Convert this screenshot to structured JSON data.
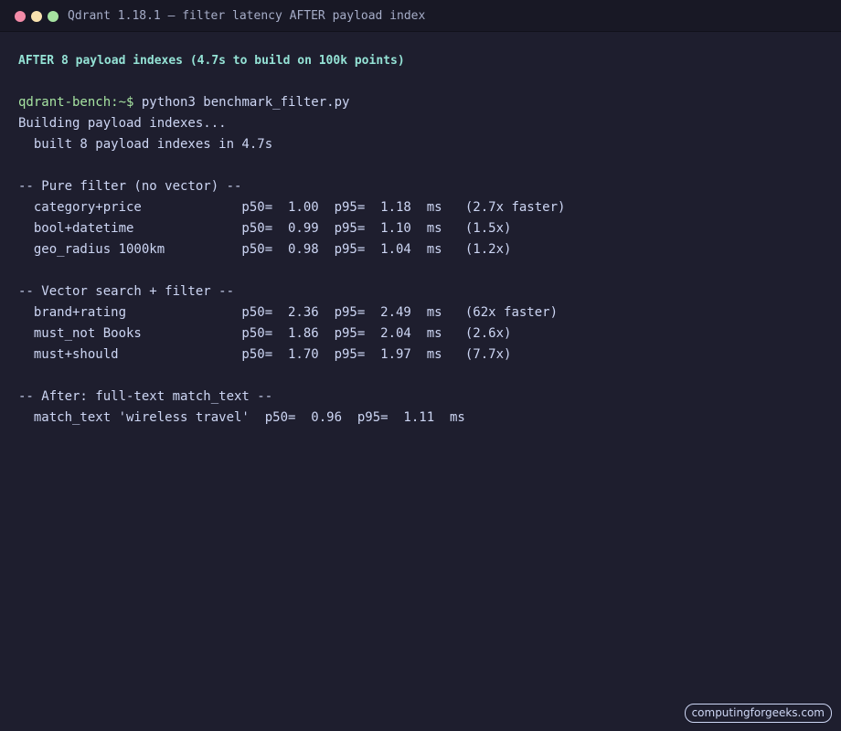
{
  "window": {
    "title": "Qdrant 1.18.1 — filter latency AFTER payload index"
  },
  "terminal": {
    "headline": "AFTER 8 payload indexes (4.7s to build on 100k points)",
    "prompt": "qdrant-bench:~$",
    "command": " python3 benchmark_filter.py",
    "lines": [
      "Building payload indexes...",
      "  built 8 payload indexes in 4.7s",
      "",
      "-- Pure filter (no vector) --",
      "  category+price             p50=  1.00  p95=  1.18  ms   (2.7x faster)",
      "  bool+datetime              p50=  0.99  p95=  1.10  ms   (1.5x)",
      "  geo_radius 1000km          p50=  0.98  p95=  1.04  ms   (1.2x)",
      "",
      "-- Vector search + filter --",
      "  brand+rating               p50=  2.36  p95=  2.49  ms   (62x faster)",
      "  must_not Books             p50=  1.86  p95=  2.04  ms   (2.6x)",
      "  must+should                p50=  1.70  p95=  1.97  ms   (7.7x)",
      "",
      "-- After: full-text match_text --",
      "  match_text 'wireless travel'  p50=  0.96  p95=  1.11  ms"
    ]
  },
  "watermark": "computingforgeeks.com",
  "colors": {
    "background": "#1e1e2e",
    "titlebar": "#181825",
    "headline": "#94e2d5",
    "prompt": "#a6e3a1",
    "text": "#cdd6f4",
    "close": "#f38ba8",
    "minimize": "#f9e2af",
    "maximize": "#a6e3a1"
  }
}
